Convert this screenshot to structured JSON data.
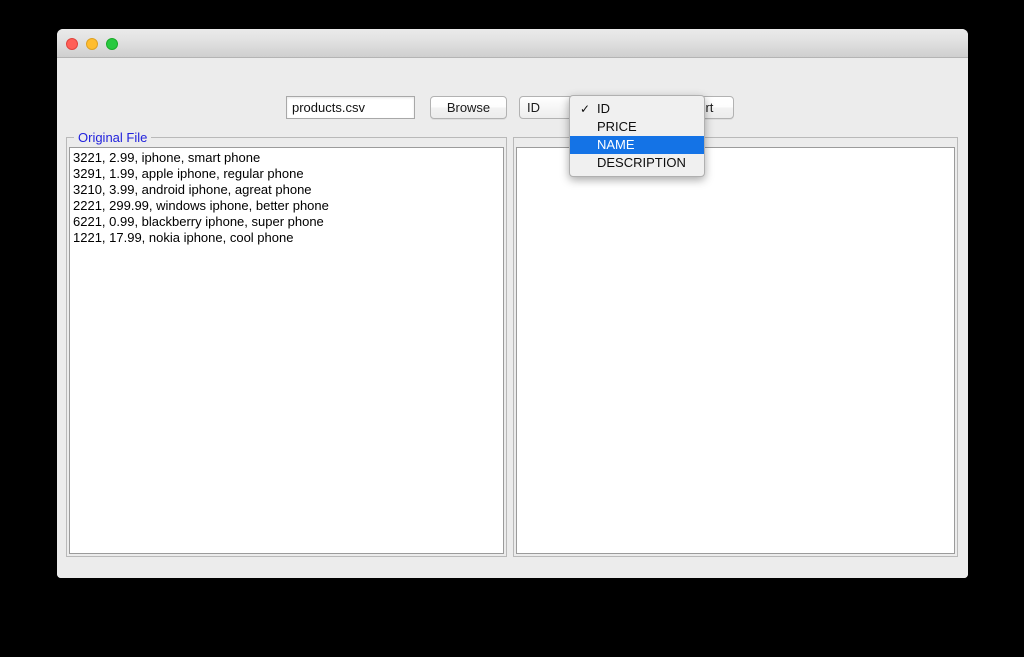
{
  "window": {
    "title": "",
    "traffic_lights": {
      "close": "close-button",
      "minimize": "minimize-button",
      "maximize": "maximize-button"
    }
  },
  "toolbar": {
    "filename_value": "products.csv",
    "filename_placeholder": "",
    "browse_label": "Browse",
    "sort_label": "Sort",
    "sort_key_selected": "ID"
  },
  "sort_key_menu": {
    "open": true,
    "checkmark": "✓",
    "items": [
      {
        "label": "ID",
        "checked": true,
        "highlighted": false
      },
      {
        "label": "PRICE",
        "checked": false,
        "highlighted": false
      },
      {
        "label": "NAME",
        "checked": false,
        "highlighted": true
      },
      {
        "label": "DESCRIPTION",
        "checked": false,
        "highlighted": false
      }
    ]
  },
  "panels": {
    "left": {
      "title": "Original File",
      "lines": [
        "3221, 2.99, iphone, smart phone",
        "3291, 1.99, apple iphone, regular phone",
        "3210, 3.99, android iphone, agreat phone",
        "2221, 299.99, windows iphone, better phone",
        "6221, 0.99, blackberry iphone, super phone",
        "1221, 17.99, nokia iphone, cool phone"
      ]
    },
    "right": {
      "title": "",
      "lines": []
    }
  },
  "colors": {
    "panel_title": "#2222dd",
    "menu_highlight": "#1473e6",
    "combo_arrow": "#3b87e0",
    "window_bg": "#ececec",
    "desktop_bg": "#000000"
  }
}
